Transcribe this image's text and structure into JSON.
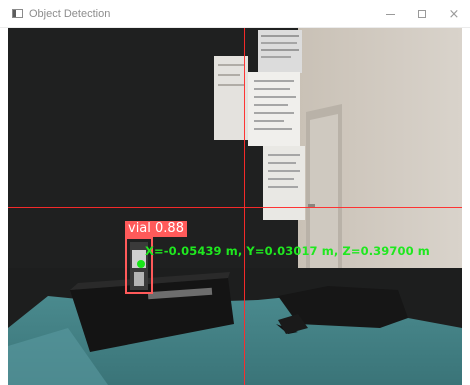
{
  "window": {
    "title": "Object Detection",
    "minimize_icon": "minimize-icon",
    "maximize_icon": "maximize-icon",
    "close_glyph": "×"
  },
  "detection": {
    "class_label": "vial",
    "confidence": "0.88",
    "coordinates_text": "X=-0.05439 m, Y=0.03017 m, Z=0.39700 m",
    "box_color": "#ff5a5a",
    "center_color": "#19e619",
    "text_color": "#1fe81f"
  },
  "crosshair": {
    "color": "#ff2b2b"
  }
}
